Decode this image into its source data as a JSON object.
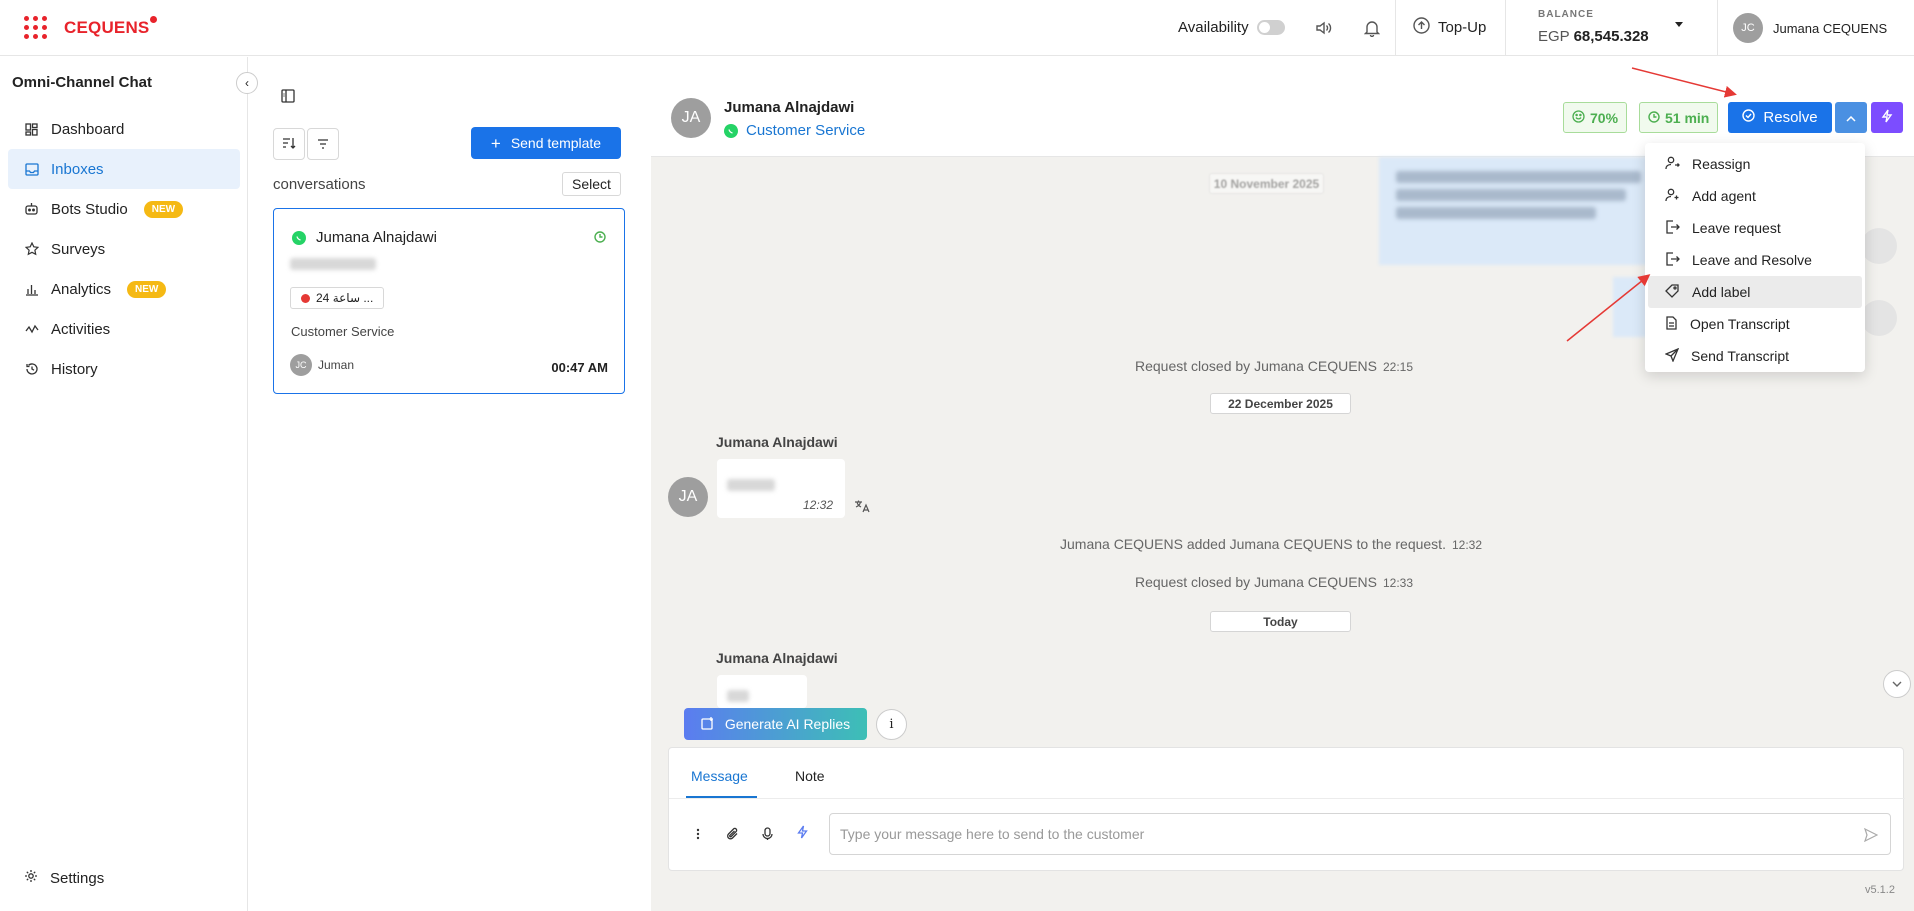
{
  "topbar": {
    "logo_text": "CEQUENS",
    "availability_label": "Availability",
    "topup_label": "Top-Up",
    "balance_label": "BALANCE",
    "balance_currency": "EGP",
    "balance_amount": "68,545.328",
    "user_initials": "JC",
    "user_name": "Jumana CEQUENS"
  },
  "sidebar": {
    "title": "Omni-Channel Chat",
    "items": [
      {
        "label": "Dashboard",
        "icon": "dashboard-icon"
      },
      {
        "label": "Inboxes",
        "icon": "inbox-icon",
        "active": true
      },
      {
        "label": "Bots Studio",
        "icon": "bot-icon",
        "badge": "NEW"
      },
      {
        "label": "Surveys",
        "icon": "star-icon"
      },
      {
        "label": "Analytics",
        "icon": "bar-chart-icon",
        "badge": "NEW"
      },
      {
        "label": "Activities",
        "icon": "activity-icon"
      },
      {
        "label": "History",
        "icon": "history-icon"
      }
    ],
    "settings_label": "Settings"
  },
  "conversations": {
    "send_template_label": "Send template",
    "section_label": "conversations",
    "select_label": "Select",
    "card": {
      "name": "Jumana Alnajdawi",
      "tag": "24 ساعة ...",
      "team": "Customer Service",
      "agent_initials": "JC",
      "agent_name": "Juman",
      "time": "00:47 AM"
    }
  },
  "chat": {
    "contact_initials": "JA",
    "contact_name": "Jumana Alnajdawi",
    "team": "Customer Service",
    "stat_score": "70%",
    "stat_time": "51 min",
    "resolve_label": "Resolve",
    "dates": [
      "10 November 2025",
      "22 December 2025",
      "Today"
    ],
    "system_messages": [
      {
        "text": "Request closed by Jumana CEQUENS",
        "time": "22:15"
      },
      {
        "text": "Jumana CEQUENS added Jumana CEQUENS to the request.",
        "time": "12:32"
      },
      {
        "text": "Request closed by Jumana CEQUENS",
        "time": "12:33"
      }
    ],
    "messages": [
      {
        "sender": "Jumana Alnajdawi",
        "initials": "JA",
        "time": "12:32"
      },
      {
        "sender": "Jumana Alnajdawi"
      }
    ],
    "generate_ai_label": "Generate AI Replies",
    "info_label": "i"
  },
  "composer": {
    "tabs": [
      "Message",
      "Note"
    ],
    "placeholder": "Type your message here to send to the customer"
  },
  "dropdown": {
    "items": [
      {
        "label": "Reassign",
        "icon": "reassign-icon"
      },
      {
        "label": "Add agent",
        "icon": "add-agent-icon"
      },
      {
        "label": "Leave request",
        "icon": "leave-icon"
      },
      {
        "label": "Leave and Resolve",
        "icon": "leave-resolve-icon"
      },
      {
        "label": "Add label",
        "icon": "tag-icon",
        "hover": true
      },
      {
        "label": "Open Transcript",
        "icon": "document-icon"
      },
      {
        "label": "Send Transcript",
        "icon": "send-icon"
      }
    ]
  },
  "version": "v5.1.2",
  "colors": {
    "brand": "#e8232b",
    "primary": "#1a73e8",
    "badge": "#f5b914",
    "status_green": "#4caf50",
    "annotation_arrow": "#e53935"
  }
}
